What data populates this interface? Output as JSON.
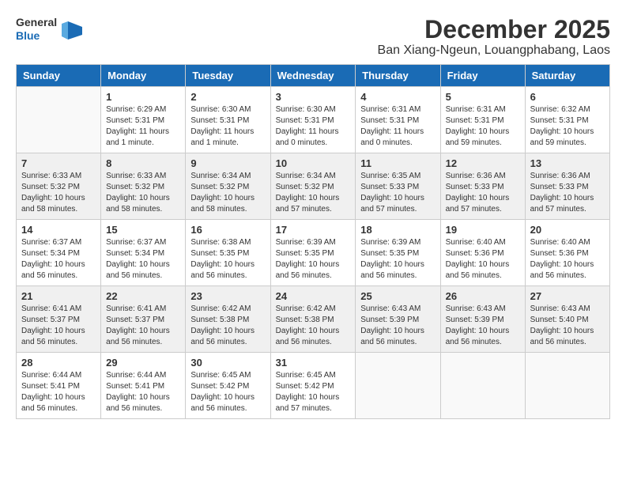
{
  "logo": {
    "general": "General",
    "blue": "Blue"
  },
  "title": "December 2025",
  "location": "Ban Xiang-Ngeun, Louangphabang, Laos",
  "weekdays": [
    "Sunday",
    "Monday",
    "Tuesday",
    "Wednesday",
    "Thursday",
    "Friday",
    "Saturday"
  ],
  "weeks": [
    [
      {
        "day": "",
        "sunrise": "",
        "sunset": "",
        "daylight": ""
      },
      {
        "day": "1",
        "sunrise": "Sunrise: 6:29 AM",
        "sunset": "Sunset: 5:31 PM",
        "daylight": "Daylight: 11 hours and 1 minute."
      },
      {
        "day": "2",
        "sunrise": "Sunrise: 6:30 AM",
        "sunset": "Sunset: 5:31 PM",
        "daylight": "Daylight: 11 hours and 1 minute."
      },
      {
        "day": "3",
        "sunrise": "Sunrise: 6:30 AM",
        "sunset": "Sunset: 5:31 PM",
        "daylight": "Daylight: 11 hours and 0 minutes."
      },
      {
        "day": "4",
        "sunrise": "Sunrise: 6:31 AM",
        "sunset": "Sunset: 5:31 PM",
        "daylight": "Daylight: 11 hours and 0 minutes."
      },
      {
        "day": "5",
        "sunrise": "Sunrise: 6:31 AM",
        "sunset": "Sunset: 5:31 PM",
        "daylight": "Daylight: 10 hours and 59 minutes."
      },
      {
        "day": "6",
        "sunrise": "Sunrise: 6:32 AM",
        "sunset": "Sunset: 5:31 PM",
        "daylight": "Daylight: 10 hours and 59 minutes."
      }
    ],
    [
      {
        "day": "7",
        "sunrise": "Sunrise: 6:33 AM",
        "sunset": "Sunset: 5:32 PM",
        "daylight": "Daylight: 10 hours and 58 minutes."
      },
      {
        "day": "8",
        "sunrise": "Sunrise: 6:33 AM",
        "sunset": "Sunset: 5:32 PM",
        "daylight": "Daylight: 10 hours and 58 minutes."
      },
      {
        "day": "9",
        "sunrise": "Sunrise: 6:34 AM",
        "sunset": "Sunset: 5:32 PM",
        "daylight": "Daylight: 10 hours and 58 minutes."
      },
      {
        "day": "10",
        "sunrise": "Sunrise: 6:34 AM",
        "sunset": "Sunset: 5:32 PM",
        "daylight": "Daylight: 10 hours and 57 minutes."
      },
      {
        "day": "11",
        "sunrise": "Sunrise: 6:35 AM",
        "sunset": "Sunset: 5:33 PM",
        "daylight": "Daylight: 10 hours and 57 minutes."
      },
      {
        "day": "12",
        "sunrise": "Sunrise: 6:36 AM",
        "sunset": "Sunset: 5:33 PM",
        "daylight": "Daylight: 10 hours and 57 minutes."
      },
      {
        "day": "13",
        "sunrise": "Sunrise: 6:36 AM",
        "sunset": "Sunset: 5:33 PM",
        "daylight": "Daylight: 10 hours and 57 minutes."
      }
    ],
    [
      {
        "day": "14",
        "sunrise": "Sunrise: 6:37 AM",
        "sunset": "Sunset: 5:34 PM",
        "daylight": "Daylight: 10 hours and 56 minutes."
      },
      {
        "day": "15",
        "sunrise": "Sunrise: 6:37 AM",
        "sunset": "Sunset: 5:34 PM",
        "daylight": "Daylight: 10 hours and 56 minutes."
      },
      {
        "day": "16",
        "sunrise": "Sunrise: 6:38 AM",
        "sunset": "Sunset: 5:35 PM",
        "daylight": "Daylight: 10 hours and 56 minutes."
      },
      {
        "day": "17",
        "sunrise": "Sunrise: 6:39 AM",
        "sunset": "Sunset: 5:35 PM",
        "daylight": "Daylight: 10 hours and 56 minutes."
      },
      {
        "day": "18",
        "sunrise": "Sunrise: 6:39 AM",
        "sunset": "Sunset: 5:35 PM",
        "daylight": "Daylight: 10 hours and 56 minutes."
      },
      {
        "day": "19",
        "sunrise": "Sunrise: 6:40 AM",
        "sunset": "Sunset: 5:36 PM",
        "daylight": "Daylight: 10 hours and 56 minutes."
      },
      {
        "day": "20",
        "sunrise": "Sunrise: 6:40 AM",
        "sunset": "Sunset: 5:36 PM",
        "daylight": "Daylight: 10 hours and 56 minutes."
      }
    ],
    [
      {
        "day": "21",
        "sunrise": "Sunrise: 6:41 AM",
        "sunset": "Sunset: 5:37 PM",
        "daylight": "Daylight: 10 hours and 56 minutes."
      },
      {
        "day": "22",
        "sunrise": "Sunrise: 6:41 AM",
        "sunset": "Sunset: 5:37 PM",
        "daylight": "Daylight: 10 hours and 56 minutes."
      },
      {
        "day": "23",
        "sunrise": "Sunrise: 6:42 AM",
        "sunset": "Sunset: 5:38 PM",
        "daylight": "Daylight: 10 hours and 56 minutes."
      },
      {
        "day": "24",
        "sunrise": "Sunrise: 6:42 AM",
        "sunset": "Sunset: 5:38 PM",
        "daylight": "Daylight: 10 hours and 56 minutes."
      },
      {
        "day": "25",
        "sunrise": "Sunrise: 6:43 AM",
        "sunset": "Sunset: 5:39 PM",
        "daylight": "Daylight: 10 hours and 56 minutes."
      },
      {
        "day": "26",
        "sunrise": "Sunrise: 6:43 AM",
        "sunset": "Sunset: 5:39 PM",
        "daylight": "Daylight: 10 hours and 56 minutes."
      },
      {
        "day": "27",
        "sunrise": "Sunrise: 6:43 AM",
        "sunset": "Sunset: 5:40 PM",
        "daylight": "Daylight: 10 hours and 56 minutes."
      }
    ],
    [
      {
        "day": "28",
        "sunrise": "Sunrise: 6:44 AM",
        "sunset": "Sunset: 5:41 PM",
        "daylight": "Daylight: 10 hours and 56 minutes."
      },
      {
        "day": "29",
        "sunrise": "Sunrise: 6:44 AM",
        "sunset": "Sunset: 5:41 PM",
        "daylight": "Daylight: 10 hours and 56 minutes."
      },
      {
        "day": "30",
        "sunrise": "Sunrise: 6:45 AM",
        "sunset": "Sunset: 5:42 PM",
        "daylight": "Daylight: 10 hours and 56 minutes."
      },
      {
        "day": "31",
        "sunrise": "Sunrise: 6:45 AM",
        "sunset": "Sunset: 5:42 PM",
        "daylight": "Daylight: 10 hours and 57 minutes."
      },
      {
        "day": "",
        "sunrise": "",
        "sunset": "",
        "daylight": ""
      },
      {
        "day": "",
        "sunrise": "",
        "sunset": "",
        "daylight": ""
      },
      {
        "day": "",
        "sunrise": "",
        "sunset": "",
        "daylight": ""
      }
    ]
  ]
}
